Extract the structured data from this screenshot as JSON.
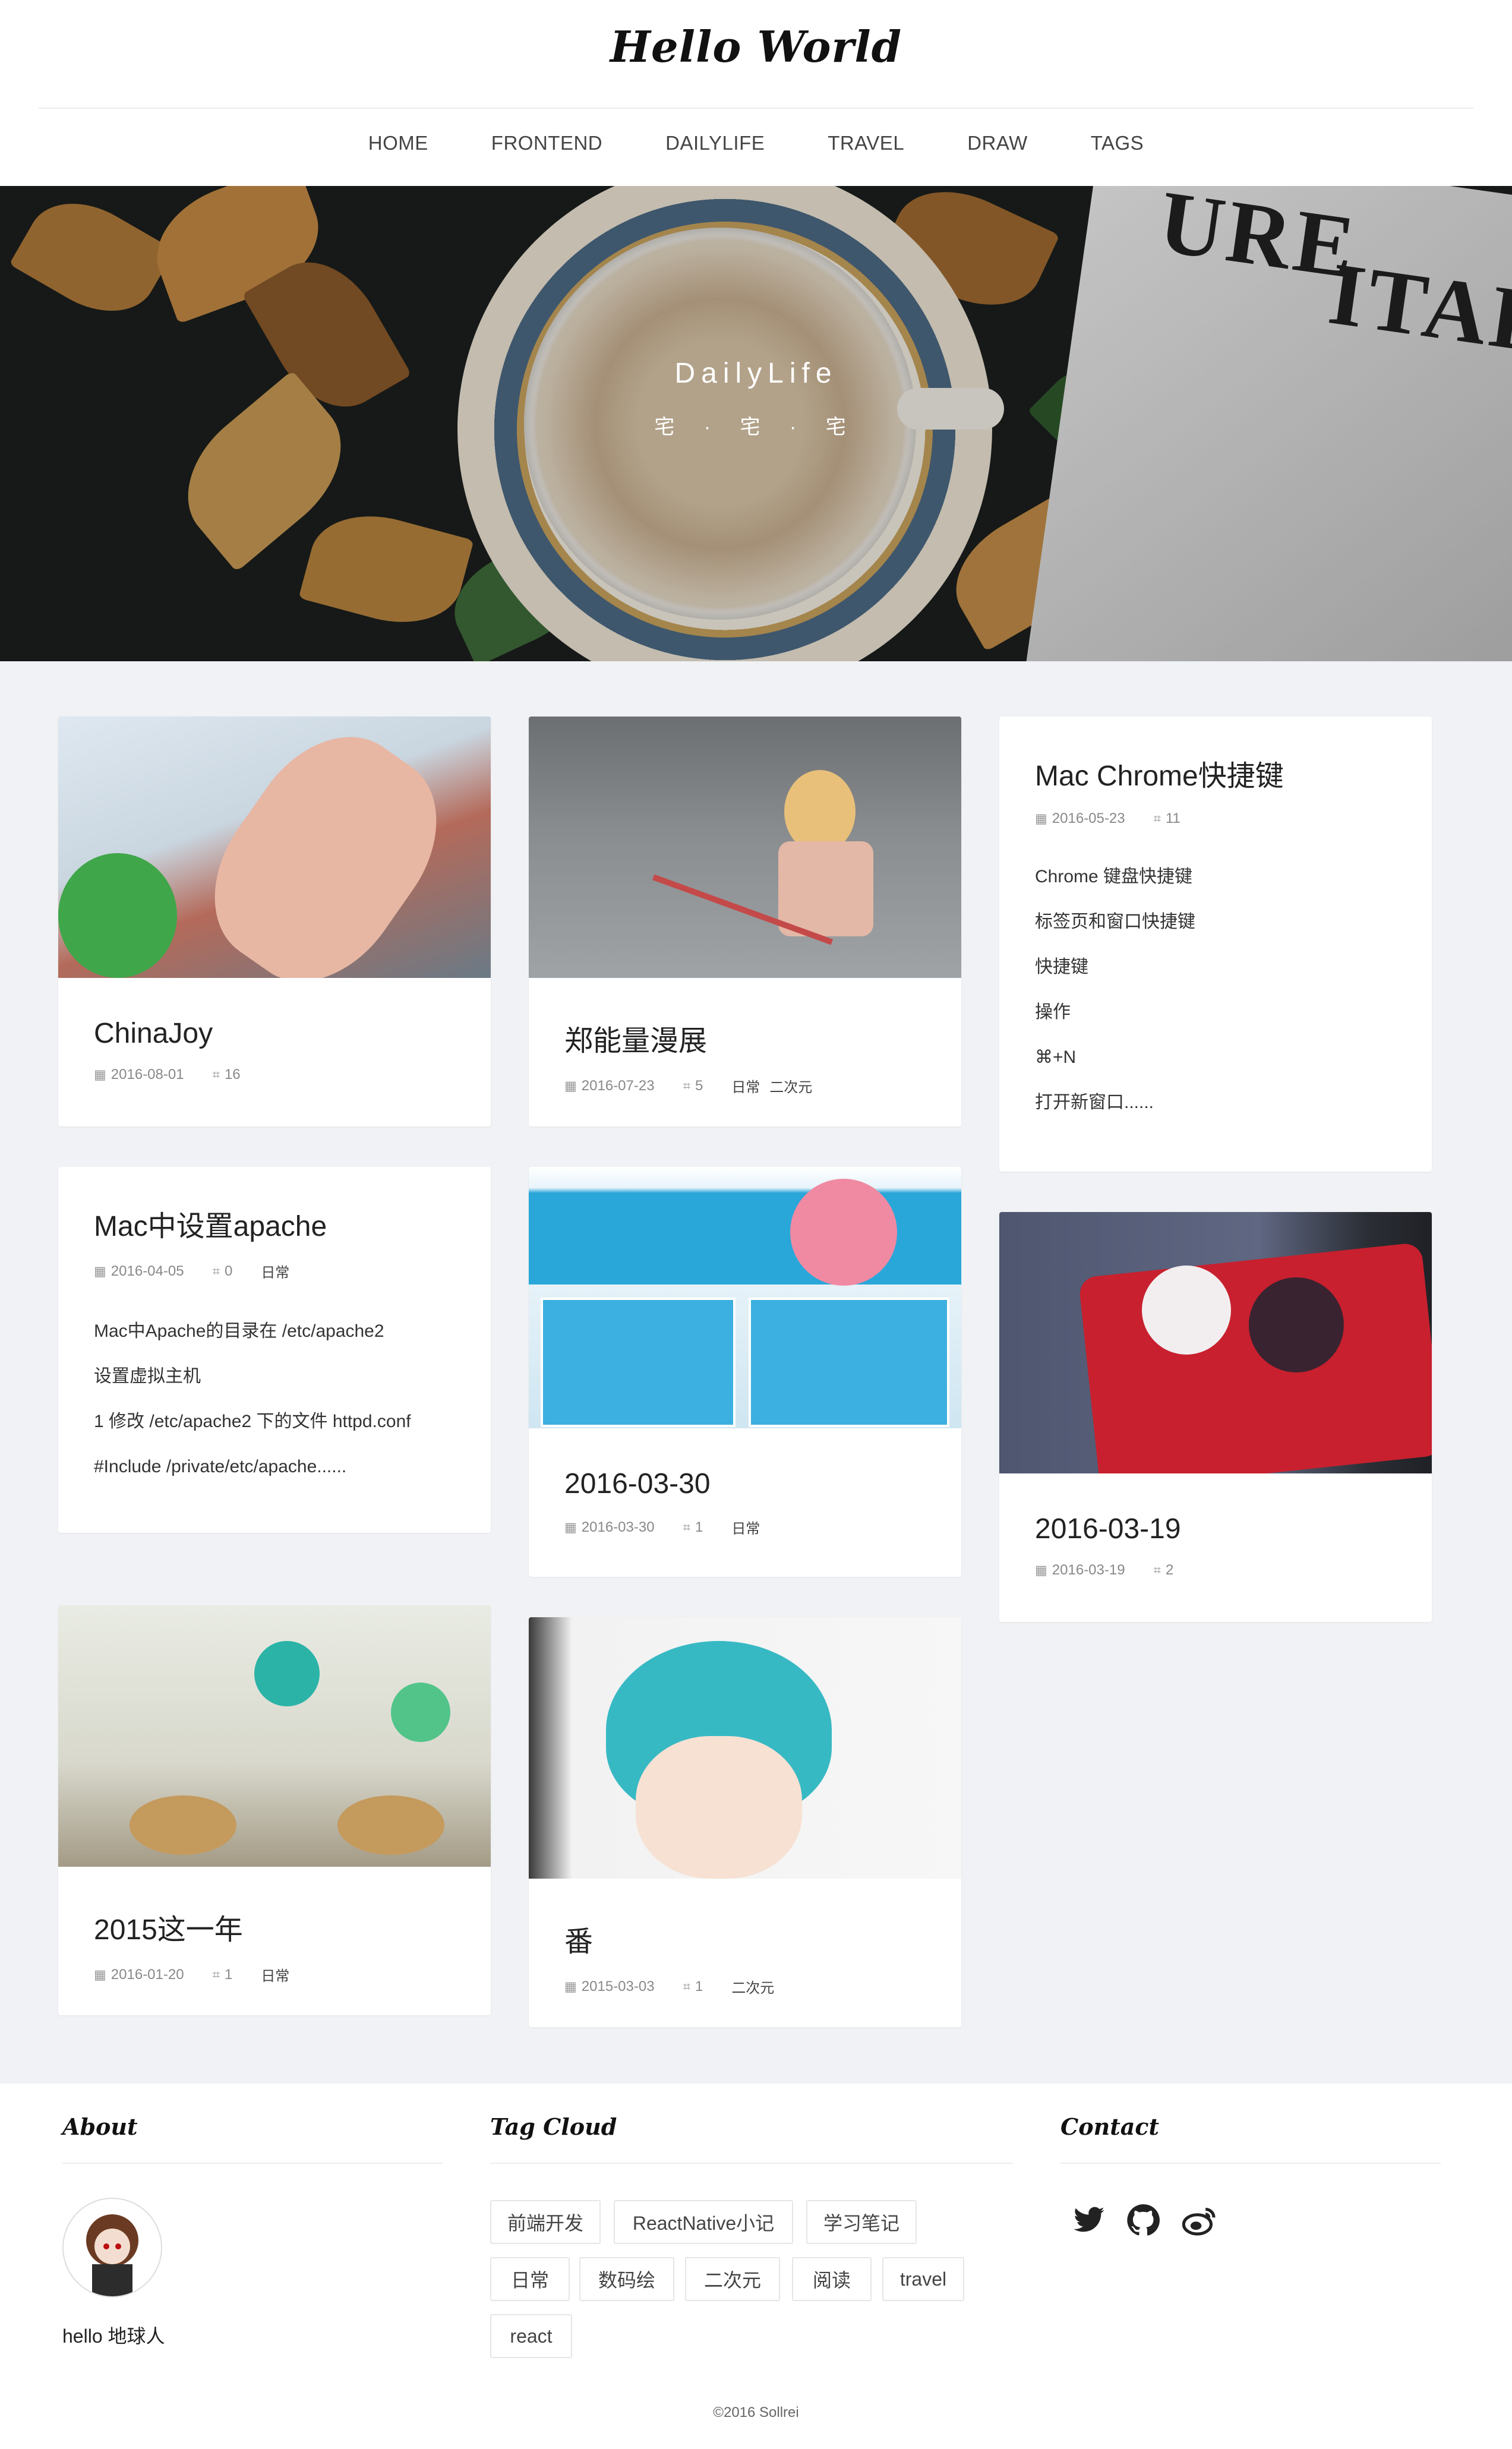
{
  "site": {
    "logo": "Hello World"
  },
  "nav": [
    "HOME",
    "FRONTEND",
    "DAILYLIFE",
    "TRAVEL",
    "DRAW",
    "TAGS"
  ],
  "hero": {
    "title": "DailyLife",
    "subtitle": "宅 · 宅 · 宅"
  },
  "posts": [
    {
      "title": "ChinaJoy",
      "date": "2016-08-01",
      "comments": "16",
      "tags": []
    },
    {
      "title": "郑能量漫展",
      "date": "2016-07-23",
      "comments": "5",
      "tags": [
        "日常",
        "二次元"
      ]
    },
    {
      "title": "Mac Chrome快捷键",
      "date": "2016-05-23",
      "comments": "11",
      "tags": [],
      "excerpt": [
        "Chrome 键盘快捷键",
        "标签页和窗口快捷键",
        "快捷键",
        "操作",
        "⌘+N",
        "打开新窗口......"
      ]
    },
    {
      "title": "Mac中设置apache",
      "date": "2016-04-05",
      "comments": "0",
      "tags": [
        "日常"
      ],
      "excerpt": [
        "Mac中Apache的目录在 /etc/apache2",
        "设置虚拟主机",
        "1 修改 /etc/apache2 下的文件 httpd.conf",
        "#Include /private/etc/apache......"
      ]
    },
    {
      "title": "2016-03-30",
      "date": "2016-03-30",
      "comments": "1",
      "tags": [
        "日常"
      ]
    },
    {
      "title": "2016-03-19",
      "date": "2016-03-19",
      "comments": "2",
      "tags": []
    },
    {
      "title": "2015这一年",
      "date": "2016-01-20",
      "comments": "1",
      "tags": [
        "日常"
      ]
    },
    {
      "title": "番",
      "date": "2015-03-03",
      "comments": "1",
      "tags": [
        "二次元"
      ]
    }
  ],
  "footer": {
    "about_title": "About",
    "about_text": "hello 地球人",
    "tagcloud_title": "Tag Cloud",
    "tags": [
      "前端开发",
      "ReactNative小记",
      "学习笔记",
      "日常",
      "数码绘",
      "二次元",
      "阅读",
      "travel",
      "react"
    ],
    "contact_title": "Contact",
    "social": [
      "twitter-icon",
      "github-icon",
      "weibo-icon"
    ],
    "copyright": "©2016 Sollrei"
  }
}
